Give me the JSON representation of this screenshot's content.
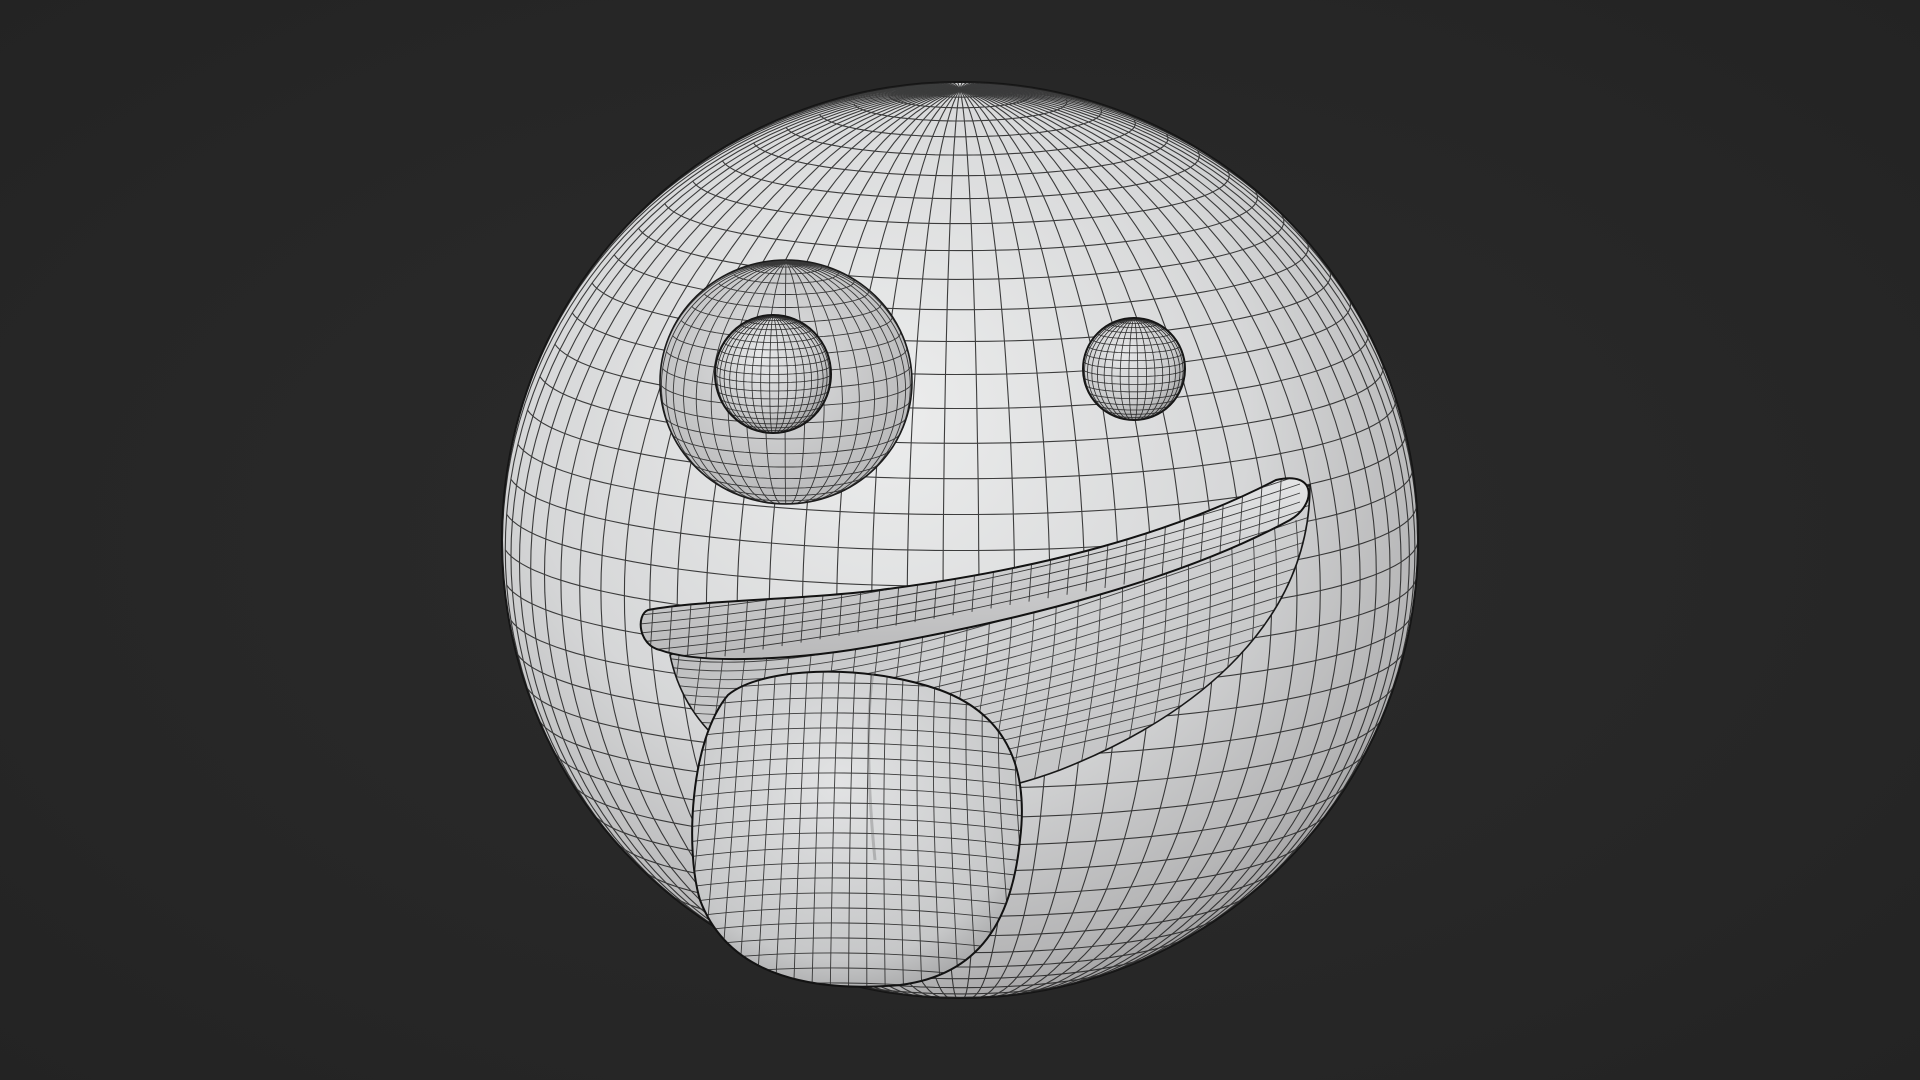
{
  "viewport": {
    "background_color": "#282828",
    "shading": "solid",
    "overlay": "wireframe"
  },
  "model": {
    "subject": "zany-face-emoji",
    "base_color": "#d9dadb",
    "wire_color": "#1e1e1e",
    "parts": [
      "head-sphere",
      "eye-socket-left",
      "eyeball-left",
      "eyeball-right",
      "mouth-upper-lip",
      "mouth-cavity",
      "tongue"
    ]
  }
}
